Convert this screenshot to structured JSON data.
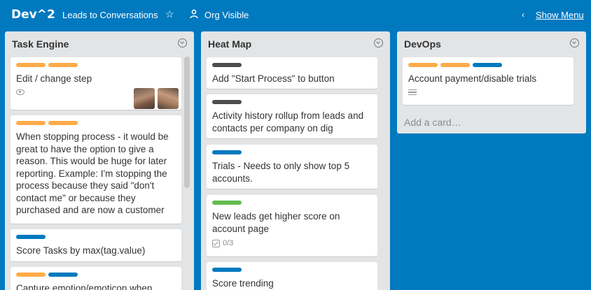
{
  "header": {
    "board_title": "Dev^2",
    "team_name": "Leads to Conversations",
    "visibility": "Org Visible",
    "show_menu": "Show Menu"
  },
  "colors": {
    "orange": "#ffab4a",
    "blue": "#0079bf",
    "dark": "#4d4d4d",
    "green": "#61bd4f"
  },
  "lists": [
    {
      "title": "Task Engine",
      "cards": [
        {
          "labels": [
            "orange",
            "orange"
          ],
          "text": "Edit / change step",
          "badges": [
            "eye-icon"
          ],
          "members": 2
        },
        {
          "labels": [
            "orange",
            "orange"
          ],
          "text": "When stopping process - it would be great to have the option to give a reason. This would be huge for later reporting. Example: I'm stopping the process because they said \"don't contact me\" or because they purchased and are now a customer"
        },
        {
          "labels": [
            "blue"
          ],
          "text": "Score Tasks by max(tag.value)"
        },
        {
          "labels": [
            "orange",
            "blue"
          ],
          "text": "Capture emotion/emoticon when"
        }
      ]
    },
    {
      "title": "Heat Map",
      "cards": [
        {
          "labels": [
            "dark"
          ],
          "text": "Add \"Start Process\" to button"
        },
        {
          "labels": [
            "dark"
          ],
          "text": "Activity history rollup from leads and contacts per company on dig"
        },
        {
          "labels": [
            "blue"
          ],
          "text": "Trials - Needs to only show top 5 accounts."
        },
        {
          "labels": [
            "green"
          ],
          "text": "New leads get higher score on account page",
          "checklist": "0/3"
        },
        {
          "labels": [
            "blue"
          ],
          "text": "Score trending"
        }
      ]
    },
    {
      "title": "DevOps",
      "cards": [
        {
          "labels": [
            "orange",
            "orange",
            "blue"
          ],
          "text": "Account payment/disable trials",
          "badges": [
            "description-icon"
          ]
        }
      ],
      "add_card": "Add a card…"
    }
  ]
}
